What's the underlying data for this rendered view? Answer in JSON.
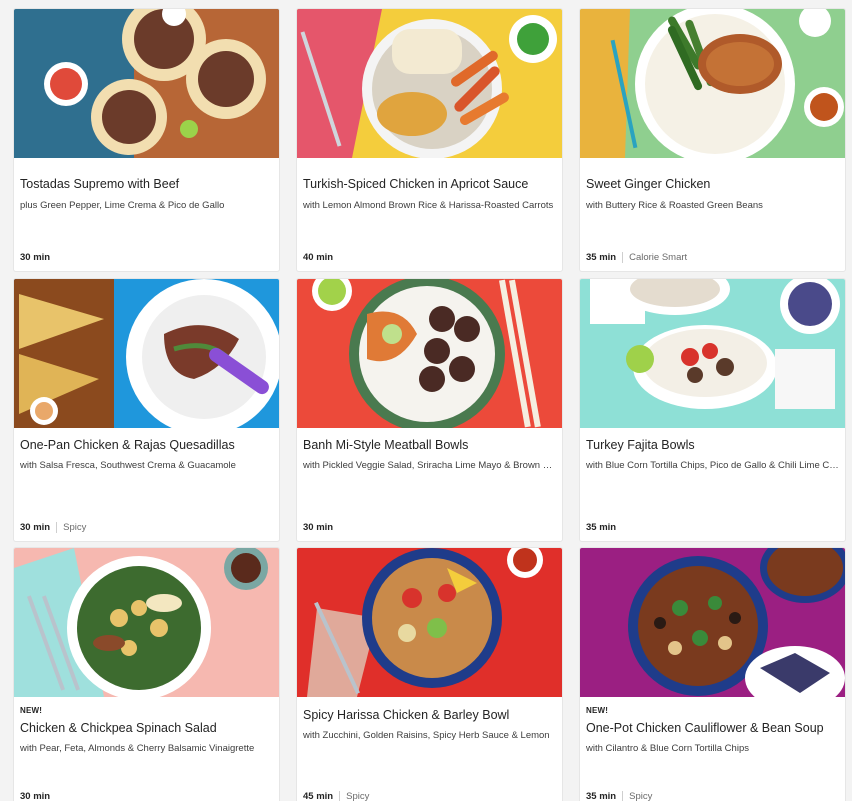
{
  "recipes": [
    {
      "title": "Tostadas Supremo with Beef",
      "subtitle": "plus Green Pepper, Lime Crema & Pico de Gallo",
      "time": "30 min",
      "tag": "",
      "badge": "",
      "colors": {
        "bg": "#2f6f8f",
        "accent": "#c7652c"
      }
    },
    {
      "title": "Turkish-Spiced Chicken in Apricot Sauce",
      "subtitle": "with Lemon Almond Brown Rice & Harissa-Roasted Carrots",
      "time": "40 min",
      "tag": "",
      "badge": "",
      "colors": {
        "bg": "#f4cd3c",
        "accent": "#d9442f"
      }
    },
    {
      "title": "Sweet Ginger Chicken",
      "subtitle": "with Buttery Rice & Roasted Green Beans",
      "time": "35 min",
      "tag": "Calorie Smart",
      "badge": "",
      "colors": {
        "bg": "#8fcf8f",
        "accent": "#e9b33d"
      }
    },
    {
      "title": "One-Pan Chicken & Rajas Quesadillas",
      "subtitle": "with Salsa Fresca, Southwest Crema & Guacamole",
      "time": "30 min",
      "tag": "Spicy",
      "badge": "",
      "colors": {
        "bg": "#1f97dc",
        "accent": "#8b4a1e"
      }
    },
    {
      "title": "Banh Mi-Style Meatball Bowls",
      "subtitle": "with Pickled Veggie Salad, Sriracha Lime Mayo & Brown Rice",
      "time": "30 min",
      "tag": "",
      "badge": "",
      "colors": {
        "bg": "#ec4a3a",
        "accent": "#4a8a4f"
      }
    },
    {
      "title": "Turkey Fajita Bowls",
      "subtitle": "with Blue Corn Tortilla Chips, Pico de Gallo & Chili Lime Crema",
      "time": "35 min",
      "tag": "",
      "badge": "",
      "colors": {
        "bg": "#8ee0d6",
        "accent": "#d8332c"
      }
    },
    {
      "title": "Chicken & Chickpea Spinach Salad",
      "subtitle": "with Pear, Feta, Almonds & Cherry Balsamic Vinaigrette",
      "time": "30 min",
      "tag": "",
      "badge": "NEW!",
      "colors": {
        "bg": "#f6b8b0",
        "accent": "#3d6b2f"
      }
    },
    {
      "title": "Spicy Harissa Chicken & Barley Bowl",
      "subtitle": "with Zucchini, Golden Raisins, Spicy Herb Sauce & Lemon",
      "time": "45 min",
      "tag": "Spicy",
      "badge": "",
      "colors": {
        "bg": "#e02f2a",
        "accent": "#1f3c8a"
      }
    },
    {
      "title": "One-Pot Chicken Cauliflower & Bean Soup",
      "subtitle": "with Cilantro & Blue Corn Tortilla Chips",
      "time": "35 min",
      "tag": "Spicy",
      "badge": "NEW!",
      "colors": {
        "bg": "#9b1f82",
        "accent": "#1f3c8a"
      }
    }
  ]
}
